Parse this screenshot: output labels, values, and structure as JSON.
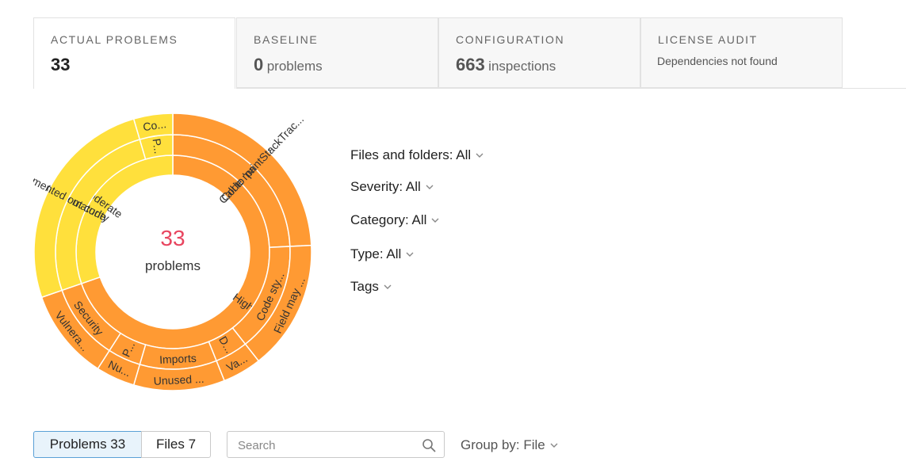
{
  "tabs": [
    {
      "title": "ACTUAL PROBLEMS",
      "value": "33",
      "unit": "",
      "sub": ""
    },
    {
      "title": "BASELINE",
      "value": "0",
      "unit": "problems",
      "sub": ""
    },
    {
      "title": "CONFIGURATION",
      "value": "663",
      "unit": "inspections",
      "sub": ""
    },
    {
      "title": "LICENSE AUDIT",
      "value": "",
      "unit": "",
      "sub": "Dependencies not found"
    }
  ],
  "summary": {
    "count": "33",
    "label": "problems"
  },
  "colors": {
    "orange": "#ff9a33",
    "yellow": "#ffe03c",
    "accent": "#e8455f",
    "selected_bg": "#e8f3fb",
    "selected_border": "#5aa0d6"
  },
  "chart_data": {
    "type": "sunburst",
    "total": 33,
    "rings": [
      {
        "level": "severity",
        "segments": [
          {
            "label": "High",
            "value": 23,
            "color": "#ff9a33"
          },
          {
            "label": "Moderate",
            "value": 10,
            "color": "#ffe03c"
          }
        ]
      },
      {
        "level": "category",
        "segments": [
          {
            "label": "Code maturity",
            "value": 8,
            "color": "#ff9a33"
          },
          {
            "label": "Code sty...",
            "value": 5,
            "color": "#ff9a33"
          },
          {
            "label": "D...",
            "value": 1.5,
            "color": "#ff9a33"
          },
          {
            "label": "Imports",
            "value": 3.5,
            "color": "#ff9a33"
          },
          {
            "label": "P...",
            "value": 1.5,
            "color": "#ff9a33"
          },
          {
            "label": "Security",
            "value": 3.5,
            "color": "#ff9a33"
          },
          {
            "label": "Code maturity",
            "value": 8.5,
            "color": "#ffe03c"
          },
          {
            "label": "P...",
            "value": 1.5,
            "color": "#ffe03c"
          }
        ]
      },
      {
        "level": "type",
        "segments": [
          {
            "label": "Call to 'printStackTrac...",
            "value": 8,
            "color": "#ff9a33"
          },
          {
            "label": "Field may ...",
            "value": 5,
            "color": "#ff9a33"
          },
          {
            "label": "Va...",
            "value": 1.5,
            "color": "#ff9a33"
          },
          {
            "label": "Unused ...",
            "value": 3.5,
            "color": "#ff9a33"
          },
          {
            "label": "Nu...",
            "value": 1.5,
            "color": "#ff9a33"
          },
          {
            "label": "Vulnera...",
            "value": 3.5,
            "color": "#ff9a33"
          },
          {
            "label": "Commented out code",
            "value": 8.5,
            "color": "#ffe03c"
          },
          {
            "label": "Co...",
            "value": 1.5,
            "color": "#ffe03c"
          }
        ]
      }
    ]
  },
  "filters": [
    {
      "label": "Files and folders: All"
    },
    {
      "label": "Severity: All"
    },
    {
      "label": "Category: All"
    },
    {
      "label": "Type: All"
    },
    {
      "label": "Tags"
    }
  ],
  "bottom": {
    "problems_btn": "Problems 33",
    "files_btn": "Files 7",
    "search_placeholder": "Search",
    "search_value": "",
    "group_by": "Group by: File"
  }
}
